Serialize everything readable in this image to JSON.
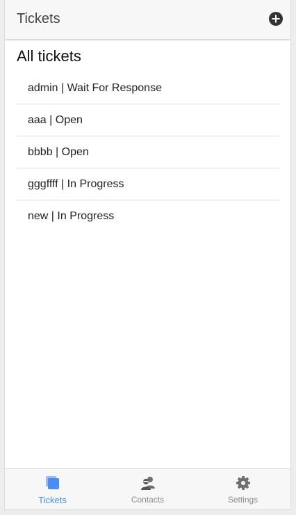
{
  "header": {
    "title": "Tickets",
    "add_icon": "plus-circle-icon"
  },
  "main": {
    "section_title": "All tickets",
    "tickets": [
      {
        "label": "admin | Wait For Response"
      },
      {
        "label": "aaa | Open"
      },
      {
        "label": "bbbb | Open"
      },
      {
        "label": "gggffff | In Progress"
      },
      {
        "label": "new | In Progress"
      }
    ]
  },
  "tabbar": {
    "tabs": [
      {
        "label": "Tickets",
        "icon": "tickets-icon",
        "active": true
      },
      {
        "label": "Contacts",
        "icon": "contacts-icon",
        "active": false
      },
      {
        "label": "Settings",
        "icon": "gear-icon",
        "active": false
      }
    ]
  },
  "colors": {
    "accent": "#4a8cf7",
    "inactive": "#8a8a8a",
    "header_bg": "#f7f7f7"
  }
}
